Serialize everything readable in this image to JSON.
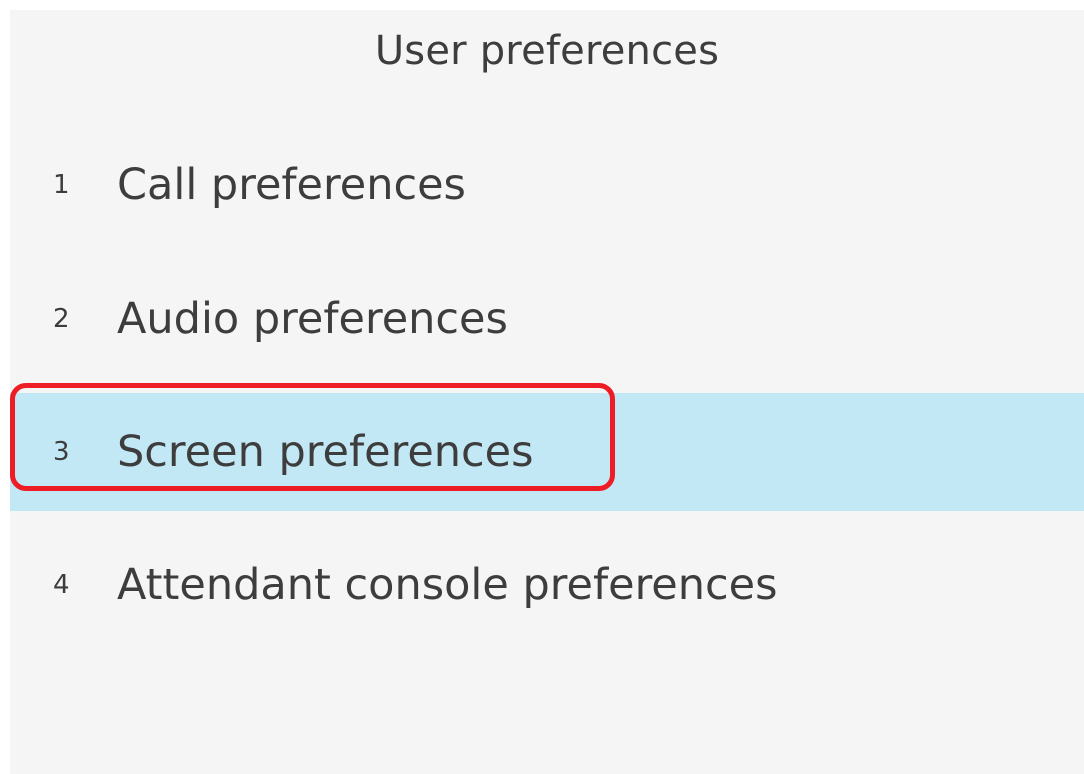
{
  "header": {
    "title": "User preferences"
  },
  "menu": {
    "items": [
      {
        "number": "1",
        "label": "Call preferences"
      },
      {
        "number": "2",
        "label": "Audio preferences"
      },
      {
        "number": "3",
        "label": "Screen preferences",
        "selected": true
      },
      {
        "number": "4",
        "label": "Attendant console preferences"
      }
    ]
  },
  "colors": {
    "background": "#f5f5f5",
    "selected_row": "#c3e8f5",
    "text": "#3d3d3d",
    "annotation_highlight": "#ee1c25"
  }
}
